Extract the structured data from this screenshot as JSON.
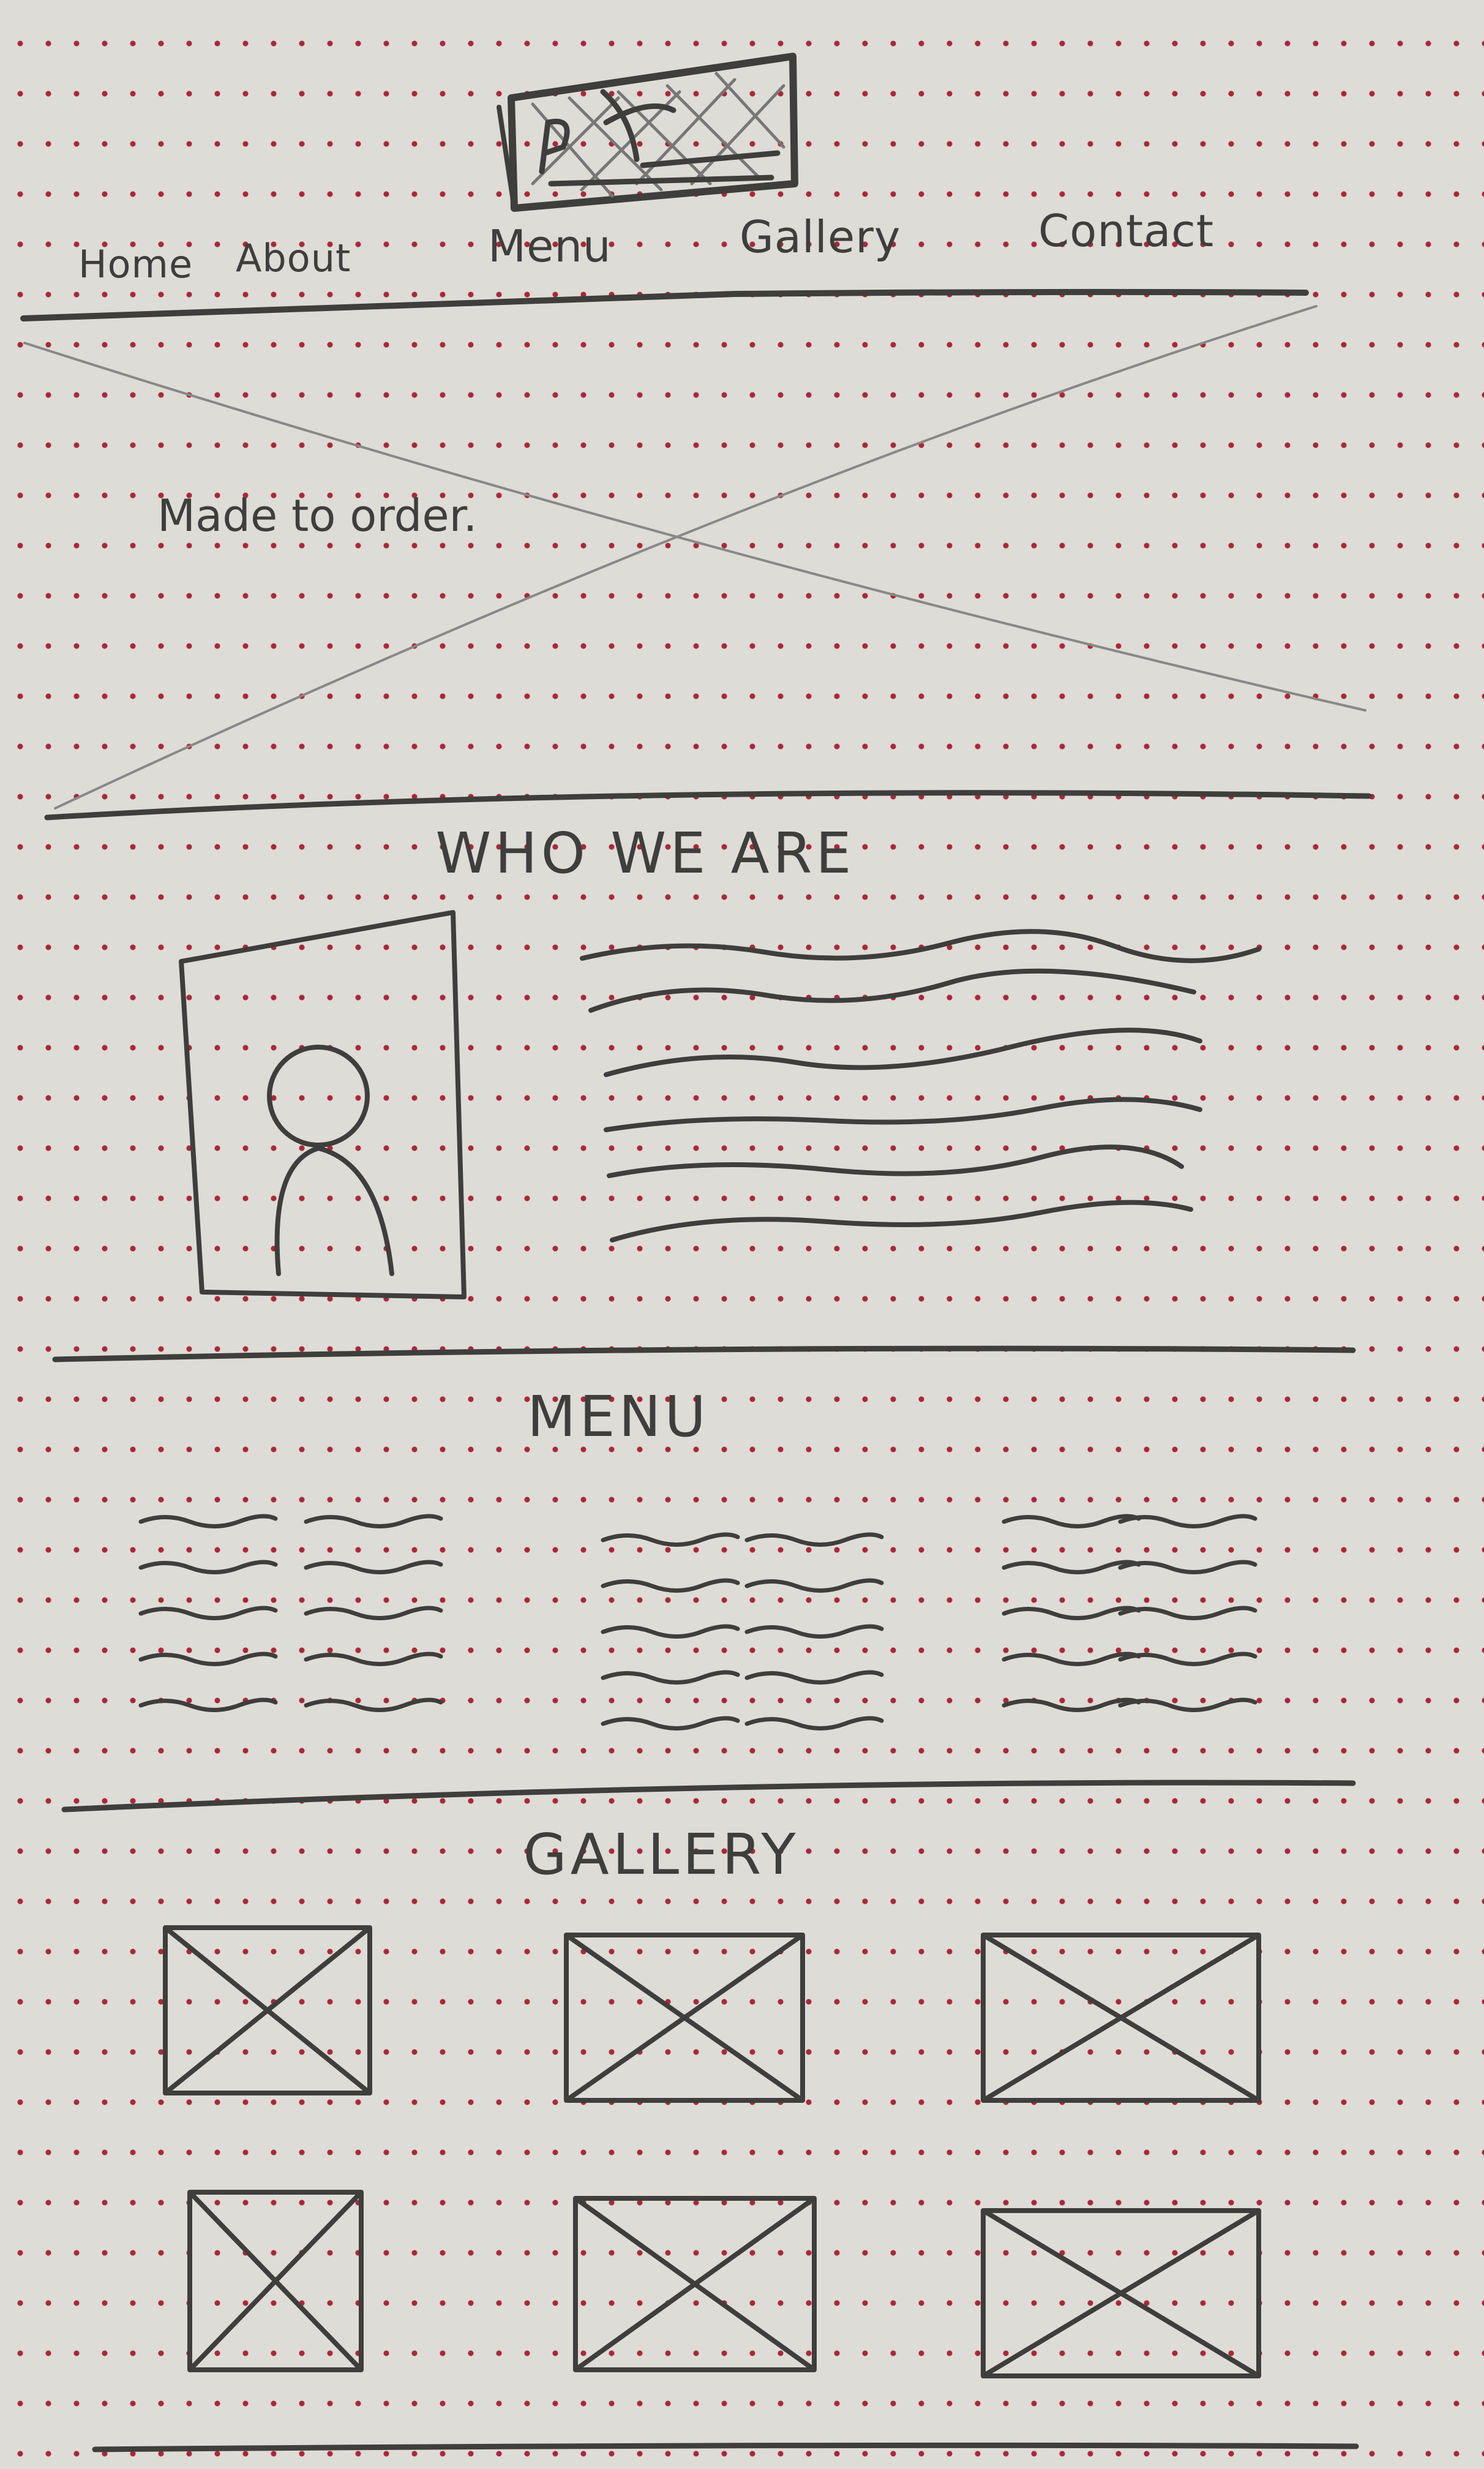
{
  "logo": {
    "label": "logo placeholder",
    "color": "#3e3e3c"
  },
  "nav": {
    "items": [
      "Home",
      "About",
      "Menu",
      "Gallery",
      "Contact"
    ]
  },
  "hero": {
    "tagline": "Made to order."
  },
  "about": {
    "title": "WHO WE ARE",
    "image": "person-portrait-placeholder",
    "text_lines": 6
  },
  "menu": {
    "title": "MENU",
    "columns": 3
  },
  "gallery": {
    "title": "GALLERY",
    "images": 6
  },
  "colors": {
    "paper": "#dedcd6",
    "dots": "#a8283a",
    "pencil": "#3e3e3c"
  }
}
